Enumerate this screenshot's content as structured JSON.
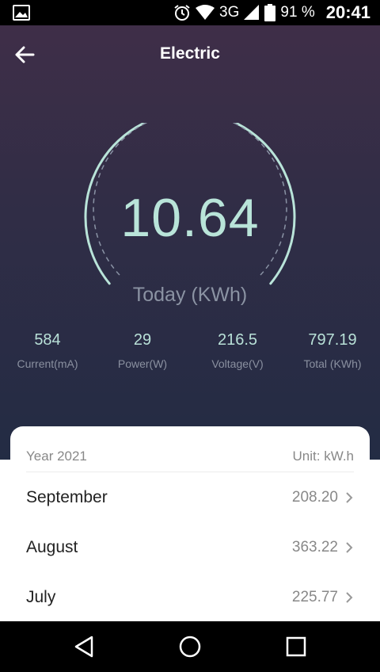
{
  "status_bar": {
    "network": "3G",
    "battery": "91 %",
    "time": "20:41"
  },
  "header": {
    "title": "Electric"
  },
  "gauge": {
    "value": "10.64",
    "label": "Today (KWh)"
  },
  "stats": [
    {
      "value": "584",
      "label": "Current(mA)"
    },
    {
      "value": "29",
      "label": "Power(W)"
    },
    {
      "value": "216.5",
      "label": "Voltage(V)"
    },
    {
      "value": "797.19",
      "label": "Total (KWh)"
    }
  ],
  "history": {
    "year": "Year 2021",
    "unit": "Unit: kW.h",
    "months": [
      {
        "name": "September",
        "value": "208.20"
      },
      {
        "name": "August",
        "value": "363.22"
      },
      {
        "name": "July",
        "value": "225.77"
      }
    ]
  },
  "colors": {
    "accent": "#b9e4d9",
    "background_top": "#3f2e48",
    "background_bottom": "#232c44"
  }
}
